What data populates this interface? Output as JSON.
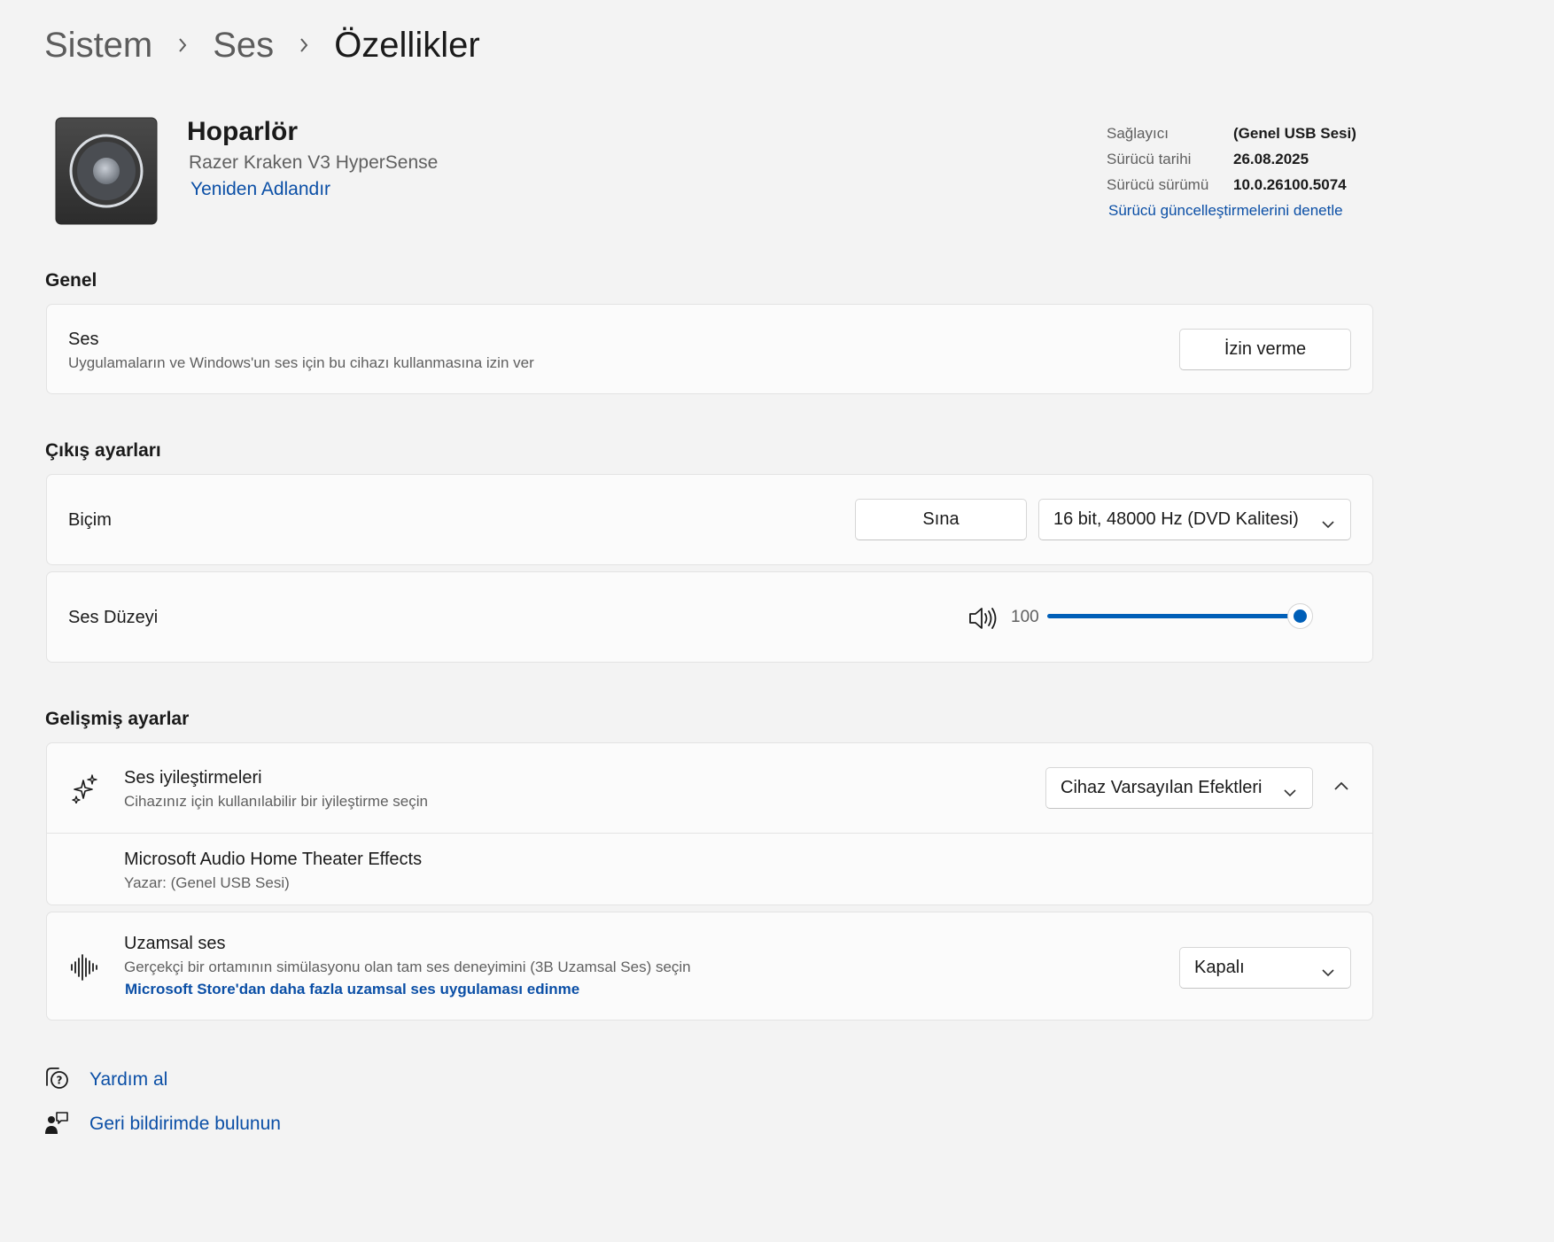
{
  "breadcrumb": {
    "items": [
      "Sistem",
      "Ses",
      "Özellikler"
    ]
  },
  "device": {
    "name": "Hoparlör",
    "model": "Razer Kraken V3 HyperSense",
    "rename_label": "Yeniden Adlandır",
    "icon": "speaker-icon"
  },
  "driver": {
    "rows": [
      {
        "label": "Sağlayıcı",
        "value": "(Genel USB Sesi)"
      },
      {
        "label": "Sürücü tarihi",
        "value": "26.08.2025"
      },
      {
        "label": "Sürücü sürümü",
        "value": "10.0.26100.5074"
      }
    ],
    "update_link": "Sürücü güncelleştirmelerini denetle"
  },
  "general": {
    "section_title": "Genel",
    "audio": {
      "title": "Ses",
      "subtitle": "Uygulamaların ve Windows'un ses için bu cihazı kullanmasına izin ver",
      "button_label": "İzin verme"
    }
  },
  "output": {
    "section_title": "Çıkış ayarları",
    "format": {
      "title": "Biçim",
      "test_label": "Sına",
      "selected": "16 bit, 48000 Hz (DVD Kalitesi)"
    },
    "volume": {
      "title": "Ses Düzeyi",
      "value": "100",
      "fraction": 1.0
    }
  },
  "advanced": {
    "section_title": "Gelişmiş ayarlar",
    "enhancements": {
      "title": "Ses iyileştirmeleri",
      "subtitle": "Cihazınız için kullanılabilir bir iyileştirme seçin",
      "selected": "Cihaz Varsayılan Efektleri",
      "icon": "sparkle-icon"
    },
    "effect": {
      "title": "Microsoft Audio Home Theater Effects",
      "author": "Yazar: (Genel USB Sesi)"
    },
    "spatial": {
      "title": "Uzamsal ses",
      "subtitle": "Gerçekçi bir ortamının simülasyonu olan tam ses deneyimini (3B Uzamsal Ses) seçin",
      "store_link": "Microsoft Store'dan daha fazla uzamsal ses uygulaması edinme",
      "selected": "Kapalı",
      "icon": "waveform-icon"
    }
  },
  "footer": {
    "help": "Yardım al",
    "feedback": "Geri bildirimde bulunun"
  },
  "colors": {
    "accent": "#005fb8",
    "link": "#0b4fa6",
    "background": "#f3f3f3",
    "card": "#fbfbfb"
  }
}
